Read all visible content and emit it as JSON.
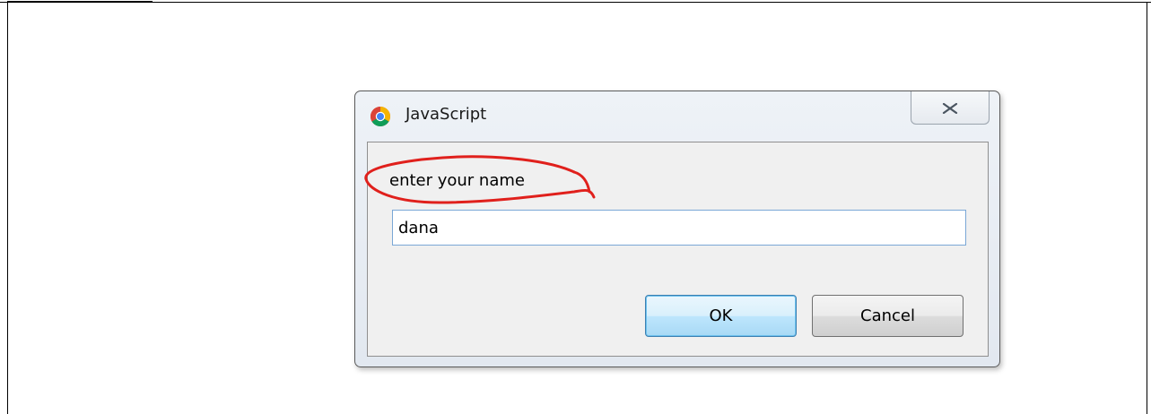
{
  "dialog": {
    "title": "JavaScript",
    "prompt": "enter your name",
    "input_value": "dana",
    "ok_label": "OK",
    "cancel_label": "Cancel",
    "icon": "chrome-icon",
    "close_icon": "close-icon"
  },
  "annotation": {
    "color": "#e0201c",
    "shape": "hand-drawn-circle"
  }
}
